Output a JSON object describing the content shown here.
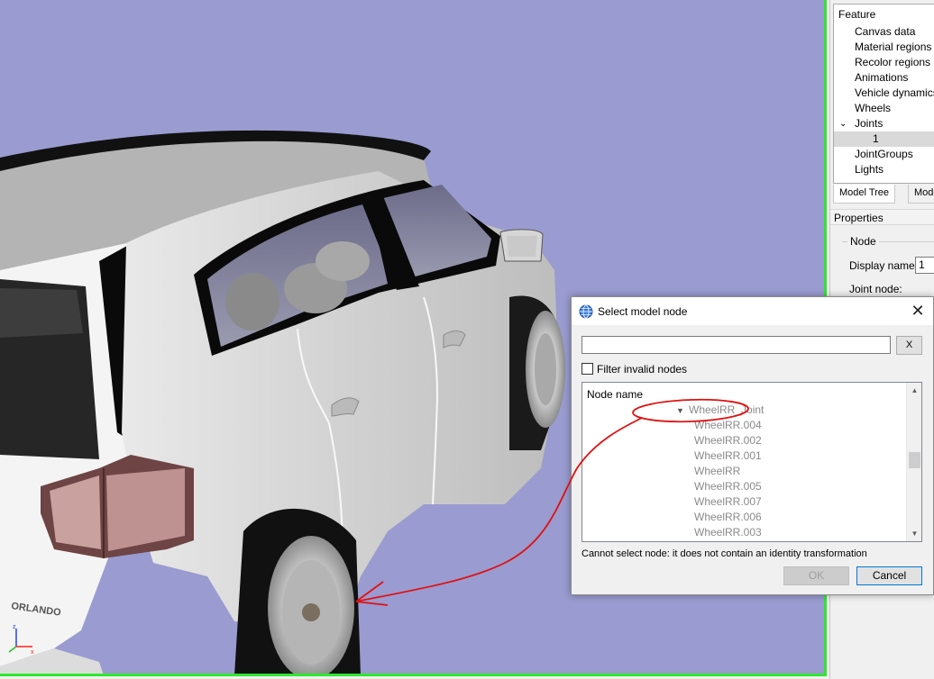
{
  "viewport": {
    "background": "#9a9bd0",
    "frame_color": "#2ee82e",
    "badge_text": "ORLANDO"
  },
  "feature_tree": {
    "header": "Feature",
    "items": [
      {
        "label": "Canvas data"
      },
      {
        "label": "Material regions"
      },
      {
        "label": "Recolor regions"
      },
      {
        "label": "Animations"
      },
      {
        "label": "Vehicle dynamics"
      },
      {
        "label": "Wheels"
      },
      {
        "label": "Joints",
        "expanded": true
      },
      {
        "label": "1",
        "selected": true
      },
      {
        "label": "JointGroups"
      },
      {
        "label": "Lights"
      }
    ]
  },
  "panel_tabs": {
    "model_tree": "Model Tree",
    "model": "Mode"
  },
  "properties": {
    "header": "Properties",
    "node_group": "Node",
    "display_name_label": "Display name:",
    "display_name_value": "1",
    "joint_node_label": "Joint node:"
  },
  "dialog": {
    "title": "Select model node",
    "close_glyph": "✕",
    "search_value": "",
    "clear_button": "X",
    "filter_label": "Filter invalid nodes",
    "filter_checked": false,
    "list_header": "Node name",
    "nodes": [
      {
        "name": "WheelRR_Joint",
        "expanded": true
      },
      {
        "name": "WheelRR.004"
      },
      {
        "name": "WheelRR.002"
      },
      {
        "name": "WheelRR.001"
      },
      {
        "name": "WheelRR"
      },
      {
        "name": "WheelRR.005"
      },
      {
        "name": "WheelRR.007"
      },
      {
        "name": "WheelRR.006"
      },
      {
        "name": "WheelRR.003"
      }
    ],
    "status_message": "Cannot select node: it does not contain an identity transformation",
    "ok_button": "OK",
    "cancel_button": "Cancel"
  },
  "annotation_color": "#e01010"
}
